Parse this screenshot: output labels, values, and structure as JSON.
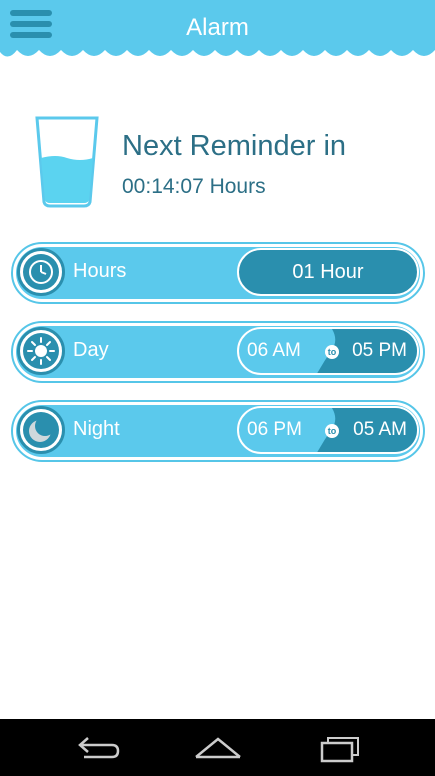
{
  "header": {
    "title": "Alarm"
  },
  "reminder": {
    "title": "Next Reminder in",
    "time": "00:14:07 Hours"
  },
  "rows": {
    "hours": {
      "label": "Hours",
      "value": "01 Hour"
    },
    "day": {
      "label": "Day",
      "from": "06 AM",
      "to_word": "to",
      "to": "05 PM"
    },
    "night": {
      "label": "Night",
      "from": "06 PM",
      "to_word": "to",
      "to": "05 AM"
    }
  },
  "colors": {
    "header": "#5bc9ec",
    "accent": "#2a8fae",
    "text": "#2c6f86",
    "row": "#5bc9ec"
  },
  "icons": {
    "menu": "menu-icon",
    "glass": "water-glass-icon",
    "clock": "clock-icon",
    "sun": "sun-icon",
    "moon": "moon-icon",
    "back": "back-icon",
    "home": "home-icon",
    "recents": "recents-icon"
  }
}
